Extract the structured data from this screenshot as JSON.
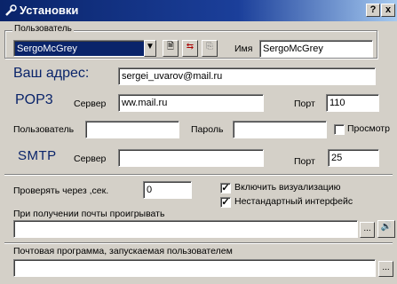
{
  "window": {
    "title": "Установки",
    "help_btn": "?",
    "close_btn": "x"
  },
  "user": {
    "group_label": "Пользователь",
    "selected": "SergoMcGrey",
    "name_label": "Имя",
    "name_value": "SergoMcGrey"
  },
  "address": {
    "label": "Ваш адрес:",
    "value": "sergei_uvarov@mail.ru"
  },
  "pop3": {
    "label": "POP3",
    "server_label": "Сервер",
    "server_value": "ww.mail.ru",
    "port_label": "Порт",
    "port_value": "110",
    "user_label": "Пользователь",
    "user_value": "",
    "password_label": "Пароль",
    "password_value": "",
    "view_label": "Просмотр"
  },
  "smtp": {
    "label": "SMTP",
    "server_label": "Сервер",
    "server_value": "",
    "port_label": "Порт",
    "port_value": "25"
  },
  "check": {
    "label": "Проверять через ,сек.",
    "value": "0"
  },
  "options": {
    "visualization_label": "Включить визуализацию",
    "custom_ui_label": "Нестандартный интерфейс"
  },
  "sound": {
    "label": "При получении почты проигрывать",
    "value": "",
    "browse": "..."
  },
  "mailer": {
    "label": "Почтовая программа, запускаемая пользователем",
    "value": "",
    "browse": "..."
  },
  "colors": {
    "title_start": "#0a246a",
    "title_end": "#a6caf0",
    "accent_text": "#0a246a"
  }
}
